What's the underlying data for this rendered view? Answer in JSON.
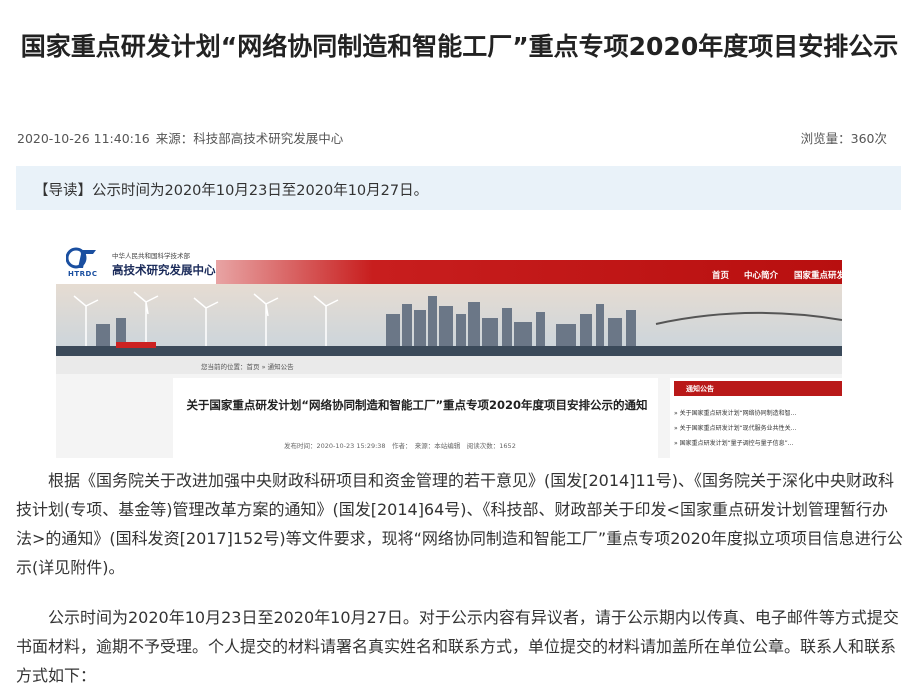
{
  "article": {
    "title": "国家重点研发计划“网络协同制造和智能工厂”重点专项2020年度项目安排公示",
    "datetime": "2020-10-26 11:40:16",
    "source_label": "来源：",
    "source": "科技部高技术研究发展中心",
    "views": "浏览量：360次",
    "lead_tag": "【导读】",
    "lead_text": "公示时间为2020年10月23日至2020年10月27日。",
    "paragraph1": "根据《国务院关于改进加强中央财政科研项目和资金管理的若干意见》(国发[2014]11号)、《国务院关于深化中央财政科技计划(专项、基金等)管理改革方案的通知》(国发[2014]64号)、《科技部、财政部关于印发<国家重点研发计划管理暂行办法>的通知》(国科发资[2017]152号)等文件要求，现将“网络协同制造和智能工厂”重点专项2020年度拟立项项目信息进行公示(详见附件)。",
    "paragraph2": "公示时间为2020年10月23日至2020年10月27日。对于公示内容有异议者，请于公示期内以传真、电子邮件等方式提交书面材料，逾期不予受理。个人提交的材料请署名真实姓名和联系方式，单位提交的材料请加盖所在单位公章。联系人和联系方式如下："
  },
  "screenshot": {
    "logo_abbr": "HTRDC",
    "org_small": "中华人民共和国科学技术部",
    "org_big": "高技术研究发展中心",
    "nav": [
      "首页",
      "中心简介",
      "国家重点研发计划重点专项"
    ],
    "breadcrumb": "您当前的位置：首页 » 通知公告",
    "article_title": "关于国家重点研发计划“网络协同制造和智能工厂”重点专项2020年度项目安排公示的通知",
    "article_meta": "发布时间：2020-10-23 15:29:38　作者：　来源：本站编辑　阅读次数：1652",
    "side_title": "通知公告",
    "side_items": [
      "» 关于国家重点研发计划“网络协同制造和智...",
      "» 关于国家重点研发计划“现代服务业共性关...",
      "» 国家重点研发计划“量子调控与量子信息”..."
    ]
  },
  "colors": {
    "lead_bg": "#e9f2f9",
    "nav_red": "#b80f0f"
  }
}
